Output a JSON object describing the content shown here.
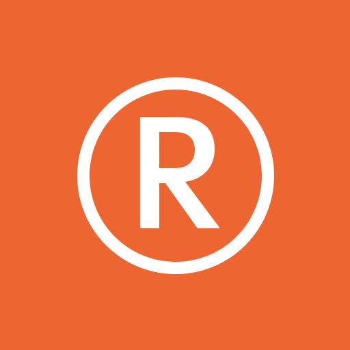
{
  "icon": {
    "name": "registered-trademark-icon",
    "letter": "R"
  },
  "colors": {
    "background": "#ED6631",
    "foreground": "#FFFFFF"
  }
}
